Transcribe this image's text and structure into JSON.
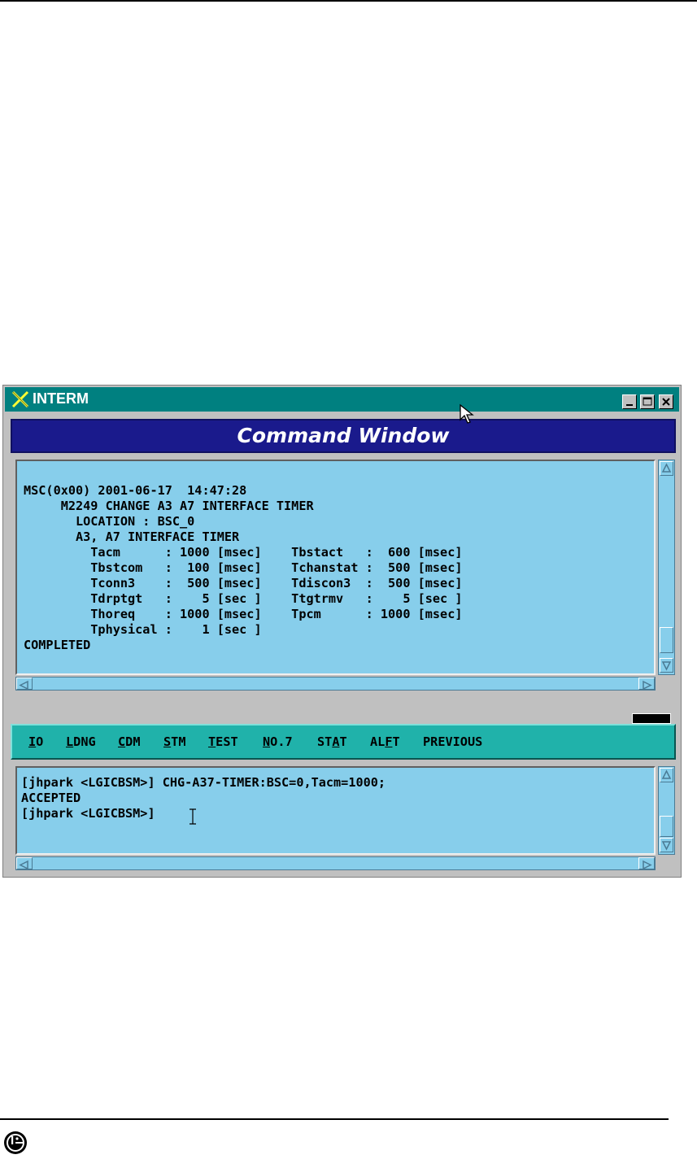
{
  "window": {
    "title": "INTERM",
    "controls": [
      "minimize",
      "maximize",
      "close"
    ]
  },
  "command_window": {
    "header": "Command Window",
    "output_lines": [
      "MSC(0x00) 2001-06-17  14:47:28",
      "     M2249 CHANGE A3 A7 INTERFACE TIMER",
      "       LOCATION : BSC_0",
      "       A3, A7 INTERFACE TIMER",
      "         Tacm      : 1000 [msec]    Tbstact   :  600 [msec]",
      "         Tbstcom   :  100 [msec]    Tchanstat :  500 [msec]",
      "         Tconn3    :  500 [msec]    Tdiscon3  :  500 [msec]",
      "         Tdrptgt   :    5 [sec ]    Ttgtrmv   :    5 [sec ]",
      "         Thoreq    : 1000 [msec]    Tpcm      : 1000 [msec]",
      "         Tphysical :    1 [sec ]",
      "COMPLETED"
    ]
  },
  "menu": [
    {
      "label": "IO",
      "hotkey_index": 0
    },
    {
      "label": "LDNG",
      "hotkey_index": 0
    },
    {
      "label": "CDM",
      "hotkey_index": 0
    },
    {
      "label": "STM",
      "hotkey_index": 0
    },
    {
      "label": "TEST",
      "hotkey_index": 0
    },
    {
      "label": "NO.7",
      "hotkey_index": 0
    },
    {
      "label": "STAT",
      "hotkey_index": 2
    },
    {
      "label": "ALFT",
      "hotkey_index": 2
    },
    {
      "label": "PREVIOUS",
      "hotkey_index": -1
    }
  ],
  "input": {
    "lines": [
      "[jhpark <LGICBSM>] CHG-A37-TIMER:BSC=0,Tacm=1000;",
      "ACCEPTED",
      "[jhpark <LGICBSM>]"
    ]
  },
  "colors": {
    "title_bar": "#008080",
    "header_bg": "#1a1a8c",
    "panel_bg": "#87ceeb",
    "menu_bg": "#20b2aa"
  },
  "icons": {
    "app": "x-logo-icon",
    "footer": "lg-logo-icon",
    "pointer": "mouse-pointer-icon"
  }
}
